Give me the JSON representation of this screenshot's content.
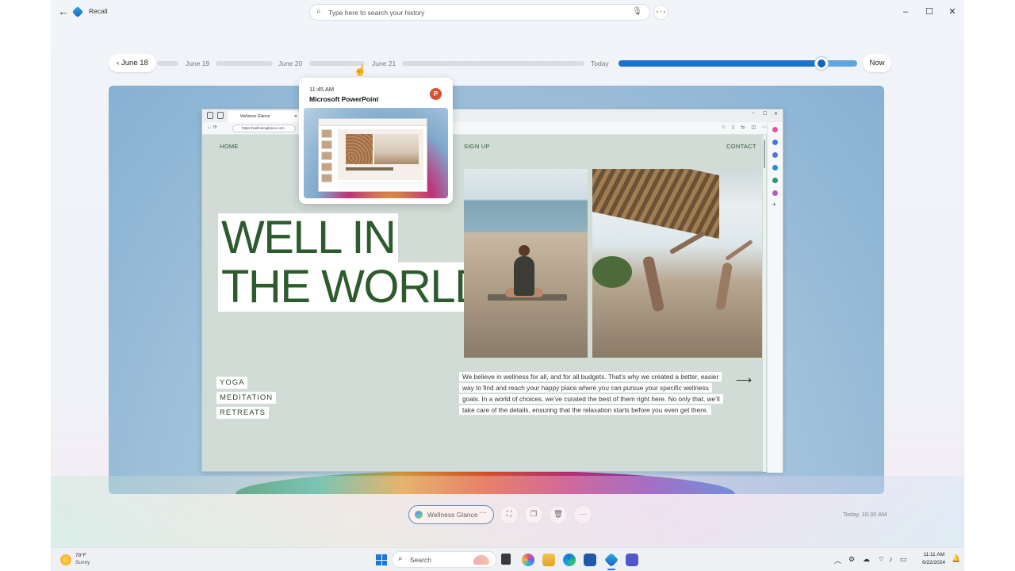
{
  "window": {
    "title": "Recall",
    "controls": {
      "minimize": "–",
      "maximize": "☐",
      "close": "✕"
    }
  },
  "search": {
    "placeholder": "Type here to search your history",
    "code_button": "‹·›"
  },
  "timeline": {
    "start_label": "June 18",
    "dates": [
      "June 19",
      "June 20",
      "June 21",
      "Today"
    ],
    "end_label": "Now",
    "position": 0.85
  },
  "hover_card": {
    "time": "11:45 AM",
    "app": "Microsoft PowerPoint",
    "icon_letter": "P"
  },
  "browser": {
    "tab_title": "Wellness Glance",
    "url": "https://wellnessglance.com",
    "site": {
      "nav": [
        "HOME",
        "SIGN UP",
        "CONTACT"
      ],
      "hero_lines": [
        "WELL IN",
        "THE WORLD"
      ],
      "menu": [
        "YOGA",
        "MEDITATION",
        "RETREATS"
      ],
      "blurb": "We believe in wellness for all, and for all budgets. That’s why we created a better, easier way to find and reach your happy place where you can pursue your specific wellness goals. In a world of choices, we’ve curated the best of them right here. No only that, we’ll take care of the details, ensuring that the relaxation starts before you even get there.",
      "arrow": "⟶"
    }
  },
  "snapshot": {
    "app_chip": "Wellness Glance",
    "more": "···",
    "timestamp": "Today, 10:30 AM"
  },
  "taskbar": {
    "weather_temp": "78°F",
    "weather_desc": "Sunny",
    "search_label": "Search",
    "clock_time": "11:11 AM",
    "clock_date": "6/22/2024"
  },
  "colors": {
    "accent": "#1a73c8",
    "hero_green": "#2d5b2d",
    "powerpoint": "#d35230"
  }
}
